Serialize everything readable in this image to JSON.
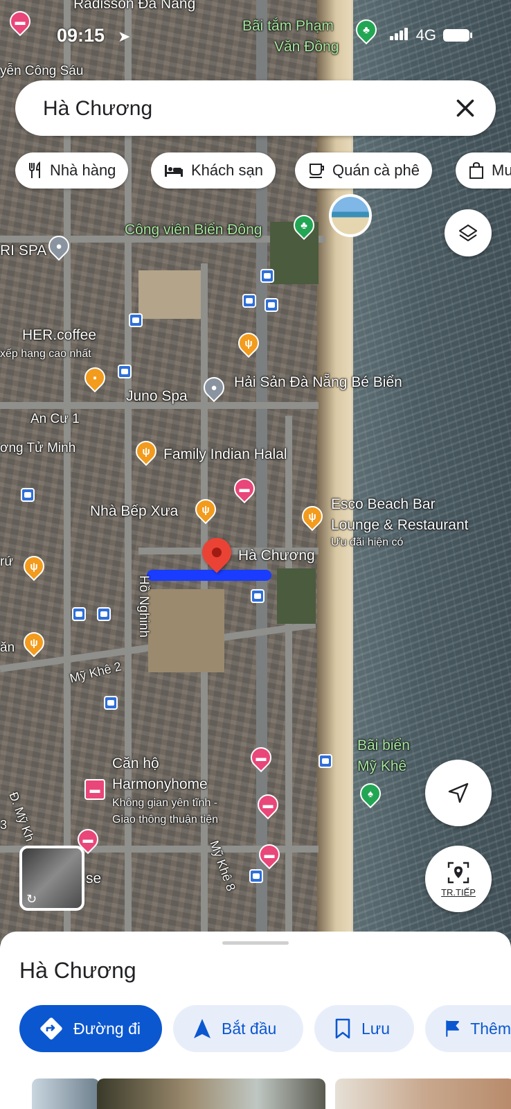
{
  "status": {
    "time": "09:15",
    "network": "4G"
  },
  "search": {
    "query": "Hà Chương"
  },
  "chips": [
    {
      "label": "Nhà hàng",
      "icon": "restaurant-icon"
    },
    {
      "label": "Khách sạn",
      "icon": "hotel-icon"
    },
    {
      "label": "Quán cà phê",
      "icon": "coffee-icon"
    },
    {
      "label": "Mu",
      "icon": "shopping-bag-icon"
    }
  ],
  "map_labels": {
    "radisson": "Radisson Đà Nẵng",
    "bai_tam": "Bãi tắm Phạm",
    "bai_tam2": "Văn Đồng",
    "nguyen_cong_sau": "yễn Công Sáu",
    "cong_vien": "Công viên Biển Đông",
    "ri_spa": "RI SPA",
    "her_coffee": "HER.coffee",
    "her_coffee_sub": "xếp hạng cao nhất",
    "hai_san": "Hải Sản Đà Nẵng Bé Biển",
    "juno_spa": "Juno Spa",
    "an_cu": "An Cư 1",
    "tu_minh": "ơng Tử Minh",
    "family_indian": "Family Indian Halal",
    "nha_bep": "Nhà Bếp Xưa",
    "esco_1": "Esco Beach Bar",
    "esco_2": "Lounge & Restaurant",
    "esco_sub": "Ưu đãi hiện có",
    "ha_chuong": "Hà Chương",
    "ho_nghinh": "Hồ Nghinh",
    "my_khe_2": "Mỹ Khê 2",
    "bai_bien_1": "Bãi biển",
    "bai_bien_2": "Mỹ Khê",
    "can_ho_1": "Căn hộ",
    "can_ho_2": "Harmonyhome",
    "can_ho_sub1": "Không gian yên tĩnh -",
    "can_ho_sub2": "Giao thông thuận tiện",
    "d_my_khe": "Đ. Mỹ Kh",
    "my_khe_8": "Mỹ Khê 8",
    "se": "se",
    "num3": "3",
    "tru": "rứ",
    "an": "ăn"
  },
  "map_buttons": {
    "tr_tiep": "TR.TIẾP"
  },
  "sheet": {
    "title": "Hà Chương",
    "actions": [
      {
        "label": "Đường đi",
        "icon": "directions-icon"
      },
      {
        "label": "Bắt đầu",
        "icon": "navigation-arrow-icon"
      },
      {
        "label": "Lưu",
        "icon": "bookmark-icon"
      },
      {
        "label": "Thêm",
        "icon": "flag-icon"
      }
    ]
  }
}
